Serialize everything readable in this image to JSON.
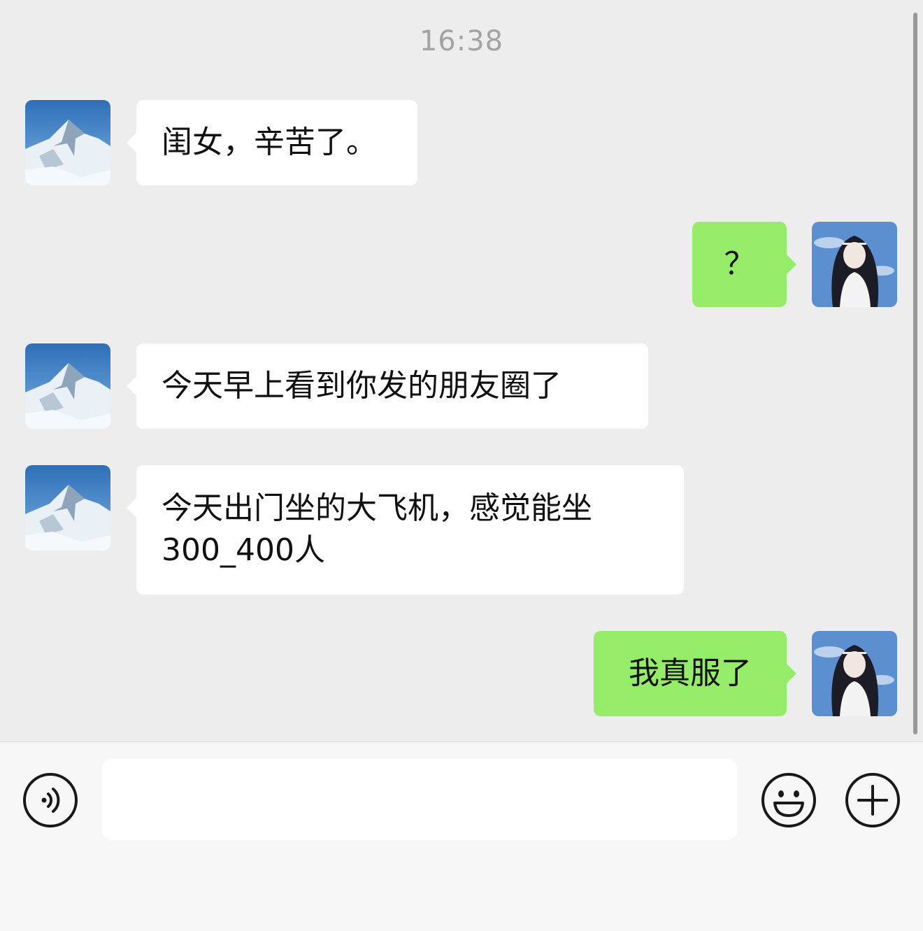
{
  "chat": {
    "timestamp": "16:38",
    "messages": [
      {
        "side": "left",
        "avatar": "mountain-avatar",
        "lines": [
          "闺女，辛苦了。"
        ]
      },
      {
        "side": "right",
        "avatar": "girl-avatar",
        "lines": [
          "？"
        ]
      },
      {
        "side": "left",
        "avatar": "mountain-avatar",
        "lines": [
          "今天早上看到你发的朋友圈了"
        ]
      },
      {
        "side": "left",
        "avatar": "mountain-avatar",
        "lines": [
          "今天出门坐的大飞机，感觉能坐",
          "300_400人"
        ]
      },
      {
        "side": "right",
        "avatar": "girl-avatar",
        "lines": [
          "我真服了"
        ]
      }
    ]
  },
  "input_bar": {
    "voice_icon": "voice-icon",
    "text_value": "",
    "emoji_icon": "emoji-icon",
    "plus_icon": "plus-icon"
  },
  "colors": {
    "background": "#ededed",
    "left_bubble": "#ffffff",
    "right_bubble": "#95ec69",
    "timestamp": "#a3a3a3"
  }
}
